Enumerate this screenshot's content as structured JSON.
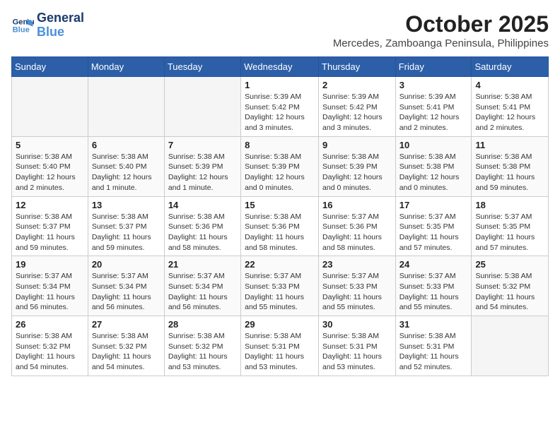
{
  "header": {
    "logo_line1": "General",
    "logo_line2": "Blue",
    "month": "October 2025",
    "location": "Mercedes, Zamboanga Peninsula, Philippines"
  },
  "days_of_week": [
    "Sunday",
    "Monday",
    "Tuesday",
    "Wednesday",
    "Thursday",
    "Friday",
    "Saturday"
  ],
  "weeks": [
    [
      {
        "day": "",
        "info": ""
      },
      {
        "day": "",
        "info": ""
      },
      {
        "day": "",
        "info": ""
      },
      {
        "day": "1",
        "info": "Sunrise: 5:39 AM\nSunset: 5:42 PM\nDaylight: 12 hours\nand 3 minutes."
      },
      {
        "day": "2",
        "info": "Sunrise: 5:39 AM\nSunset: 5:42 PM\nDaylight: 12 hours\nand 3 minutes."
      },
      {
        "day": "3",
        "info": "Sunrise: 5:39 AM\nSunset: 5:41 PM\nDaylight: 12 hours\nand 2 minutes."
      },
      {
        "day": "4",
        "info": "Sunrise: 5:38 AM\nSunset: 5:41 PM\nDaylight: 12 hours\nand 2 minutes."
      }
    ],
    [
      {
        "day": "5",
        "info": "Sunrise: 5:38 AM\nSunset: 5:40 PM\nDaylight: 12 hours\nand 2 minutes."
      },
      {
        "day": "6",
        "info": "Sunrise: 5:38 AM\nSunset: 5:40 PM\nDaylight: 12 hours\nand 1 minute."
      },
      {
        "day": "7",
        "info": "Sunrise: 5:38 AM\nSunset: 5:39 PM\nDaylight: 12 hours\nand 1 minute."
      },
      {
        "day": "8",
        "info": "Sunrise: 5:38 AM\nSunset: 5:39 PM\nDaylight: 12 hours\nand 0 minutes."
      },
      {
        "day": "9",
        "info": "Sunrise: 5:38 AM\nSunset: 5:39 PM\nDaylight: 12 hours\nand 0 minutes."
      },
      {
        "day": "10",
        "info": "Sunrise: 5:38 AM\nSunset: 5:38 PM\nDaylight: 12 hours\nand 0 minutes."
      },
      {
        "day": "11",
        "info": "Sunrise: 5:38 AM\nSunset: 5:38 PM\nDaylight: 11 hours\nand 59 minutes."
      }
    ],
    [
      {
        "day": "12",
        "info": "Sunrise: 5:38 AM\nSunset: 5:37 PM\nDaylight: 11 hours\nand 59 minutes."
      },
      {
        "day": "13",
        "info": "Sunrise: 5:38 AM\nSunset: 5:37 PM\nDaylight: 11 hours\nand 59 minutes."
      },
      {
        "day": "14",
        "info": "Sunrise: 5:38 AM\nSunset: 5:36 PM\nDaylight: 11 hours\nand 58 minutes."
      },
      {
        "day": "15",
        "info": "Sunrise: 5:38 AM\nSunset: 5:36 PM\nDaylight: 11 hours\nand 58 minutes."
      },
      {
        "day": "16",
        "info": "Sunrise: 5:37 AM\nSunset: 5:36 PM\nDaylight: 11 hours\nand 58 minutes."
      },
      {
        "day": "17",
        "info": "Sunrise: 5:37 AM\nSunset: 5:35 PM\nDaylight: 11 hours\nand 57 minutes."
      },
      {
        "day": "18",
        "info": "Sunrise: 5:37 AM\nSunset: 5:35 PM\nDaylight: 11 hours\nand 57 minutes."
      }
    ],
    [
      {
        "day": "19",
        "info": "Sunrise: 5:37 AM\nSunset: 5:34 PM\nDaylight: 11 hours\nand 56 minutes."
      },
      {
        "day": "20",
        "info": "Sunrise: 5:37 AM\nSunset: 5:34 PM\nDaylight: 11 hours\nand 56 minutes."
      },
      {
        "day": "21",
        "info": "Sunrise: 5:37 AM\nSunset: 5:34 PM\nDaylight: 11 hours\nand 56 minutes."
      },
      {
        "day": "22",
        "info": "Sunrise: 5:37 AM\nSunset: 5:33 PM\nDaylight: 11 hours\nand 55 minutes."
      },
      {
        "day": "23",
        "info": "Sunrise: 5:37 AM\nSunset: 5:33 PM\nDaylight: 11 hours\nand 55 minutes."
      },
      {
        "day": "24",
        "info": "Sunrise: 5:37 AM\nSunset: 5:33 PM\nDaylight: 11 hours\nand 55 minutes."
      },
      {
        "day": "25",
        "info": "Sunrise: 5:38 AM\nSunset: 5:32 PM\nDaylight: 11 hours\nand 54 minutes."
      }
    ],
    [
      {
        "day": "26",
        "info": "Sunrise: 5:38 AM\nSunset: 5:32 PM\nDaylight: 11 hours\nand 54 minutes."
      },
      {
        "day": "27",
        "info": "Sunrise: 5:38 AM\nSunset: 5:32 PM\nDaylight: 11 hours\nand 54 minutes."
      },
      {
        "day": "28",
        "info": "Sunrise: 5:38 AM\nSunset: 5:32 PM\nDaylight: 11 hours\nand 53 minutes."
      },
      {
        "day": "29",
        "info": "Sunrise: 5:38 AM\nSunset: 5:31 PM\nDaylight: 11 hours\nand 53 minutes."
      },
      {
        "day": "30",
        "info": "Sunrise: 5:38 AM\nSunset: 5:31 PM\nDaylight: 11 hours\nand 53 minutes."
      },
      {
        "day": "31",
        "info": "Sunrise: 5:38 AM\nSunset: 5:31 PM\nDaylight: 11 hours\nand 52 minutes."
      },
      {
        "day": "",
        "info": ""
      }
    ]
  ]
}
